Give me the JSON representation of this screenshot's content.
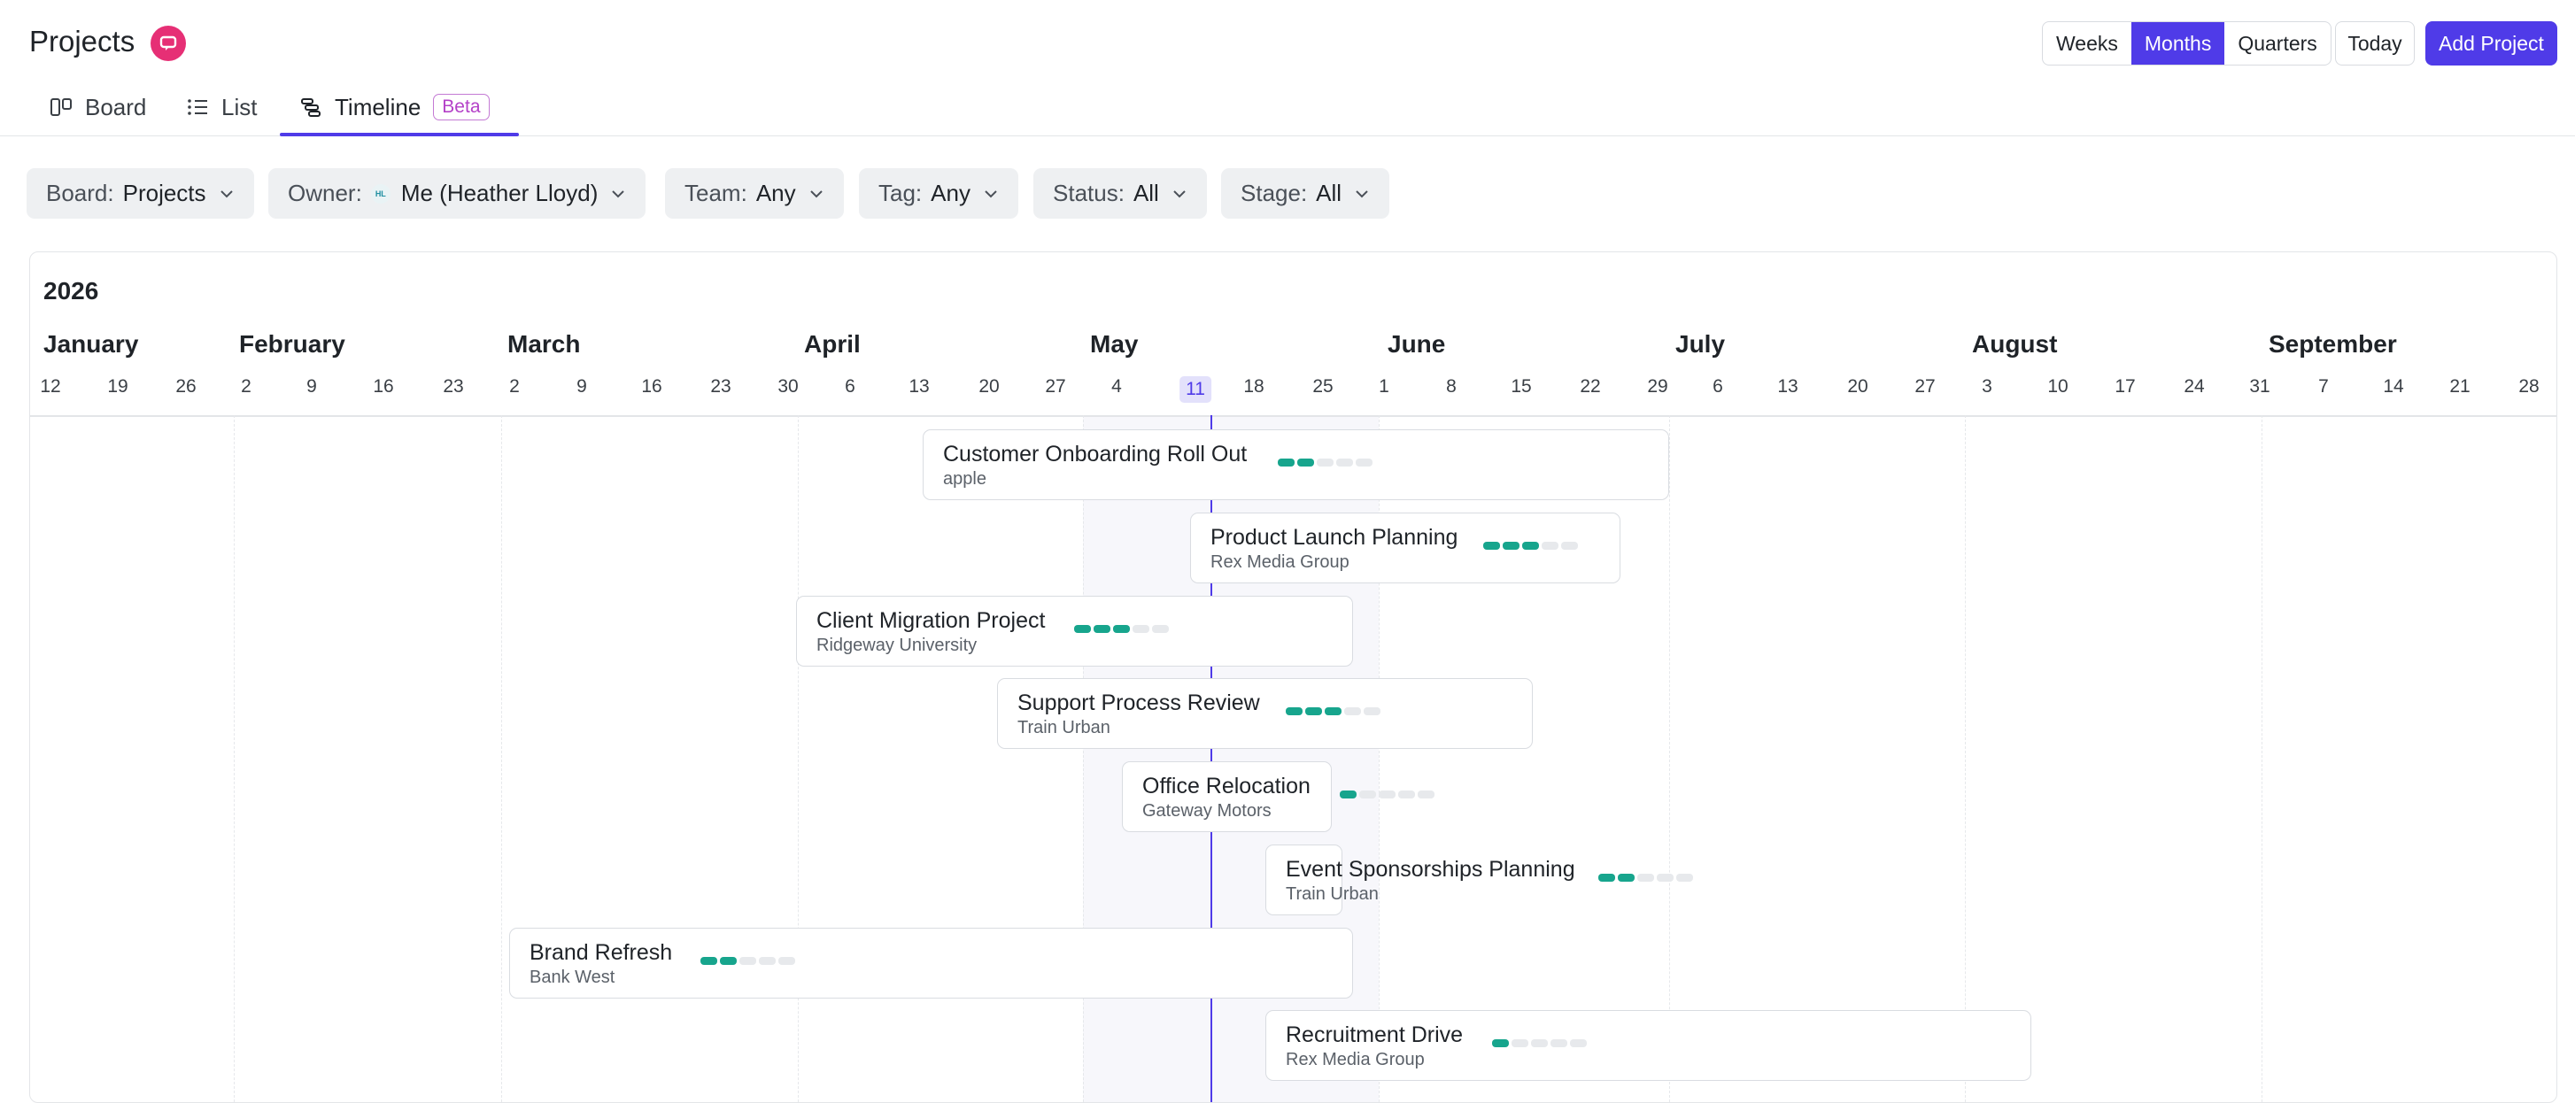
{
  "header": {
    "title": "Projects",
    "views": [
      "Weeks",
      "Months",
      "Quarters"
    ],
    "active_view": "Months",
    "today_label": "Today",
    "add_label": "Add Project"
  },
  "tabs": [
    {
      "label": "Board",
      "icon": "board-icon"
    },
    {
      "label": "List",
      "icon": "list-icon"
    },
    {
      "label": "Timeline",
      "icon": "timeline-icon",
      "badge": "Beta",
      "active": true
    }
  ],
  "filters": [
    {
      "label": "Board:",
      "value": "Projects"
    },
    {
      "label": "Owner:",
      "value": "Me (Heather Lloyd)",
      "avatar": "HL"
    },
    {
      "label": "Team:",
      "value": "Any"
    },
    {
      "label": "Tag:",
      "value": "Any"
    },
    {
      "label": "Status:",
      "value": "All"
    },
    {
      "label": "Stage:",
      "value": "All"
    }
  ],
  "timeline": {
    "year": "2026",
    "months": [
      "January",
      "February",
      "March",
      "April",
      "May",
      "June",
      "July",
      "August",
      "September"
    ],
    "weeks": [
      "12",
      "19",
      "26",
      "2",
      "9",
      "16",
      "23",
      "2",
      "9",
      "16",
      "23",
      "30",
      "6",
      "13",
      "20",
      "27",
      "4",
      "11",
      "18",
      "25",
      "1",
      "8",
      "15",
      "22",
      "29",
      "6",
      "13",
      "20",
      "27",
      "3",
      "10",
      "17",
      "24",
      "31",
      "7",
      "14",
      "21",
      "28"
    ],
    "today_week": "11",
    "projects": [
      {
        "name": "Customer Onboarding Roll Out",
        "client": "apple",
        "progress": 0.33
      },
      {
        "name": "Product Launch Planning",
        "client": "Rex Media Group",
        "progress": 0.5
      },
      {
        "name": "Client Migration Project",
        "client": "Ridgeway University",
        "progress": 0.6
      },
      {
        "name": "Support Process Review",
        "client": "Train Urban",
        "progress": 0.6
      },
      {
        "name": "Office Relocation",
        "client": "Gateway Motors",
        "progress": 0.2
      },
      {
        "name": "Event Sponsorships Planning",
        "client": "Train Urban",
        "progress": 0.4
      },
      {
        "name": "Brand Refresh",
        "client": "Bank West",
        "progress": 0.4
      },
      {
        "name": "Recruitment Drive",
        "client": "Rex Media Group",
        "progress": 0.2
      }
    ]
  },
  "colors": {
    "accent": "#4f3be8",
    "badge": "#e62f75",
    "progress": "#17a58d",
    "beta": "#b441c8"
  }
}
